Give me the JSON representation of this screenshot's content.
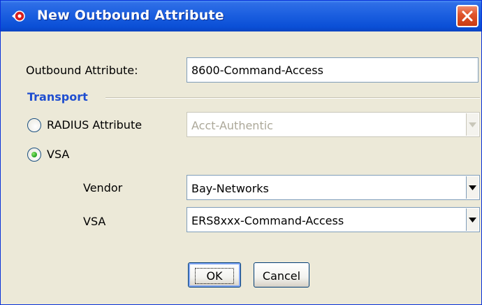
{
  "window": {
    "title": "New Outbound Attribute",
    "icon": "app-logo-icon",
    "close_icon": "close-icon",
    "accent": "#0a4fd6",
    "close_color": "#e0552c"
  },
  "form": {
    "outbound_attribute_label": "Outbound Attribute:",
    "outbound_attribute_value": "8600-Command-Access",
    "transport_title": "Transport",
    "transport_title_color": "#1f4ed0",
    "radius_option_label": "RADIUS Attribute",
    "radius_option_selected": false,
    "radius_attribute_value": "Acct-Authentic",
    "radius_attribute_enabled": false,
    "vsa_option_label": "VSA",
    "vsa_option_selected": true,
    "vendor_label": "Vendor",
    "vendor_value": "Bay-Networks",
    "vsa_label": "VSA",
    "vsa_value": "ERS8xxx-Command-Access"
  },
  "buttons": {
    "ok_label": "OK",
    "cancel_label": "Cancel"
  }
}
